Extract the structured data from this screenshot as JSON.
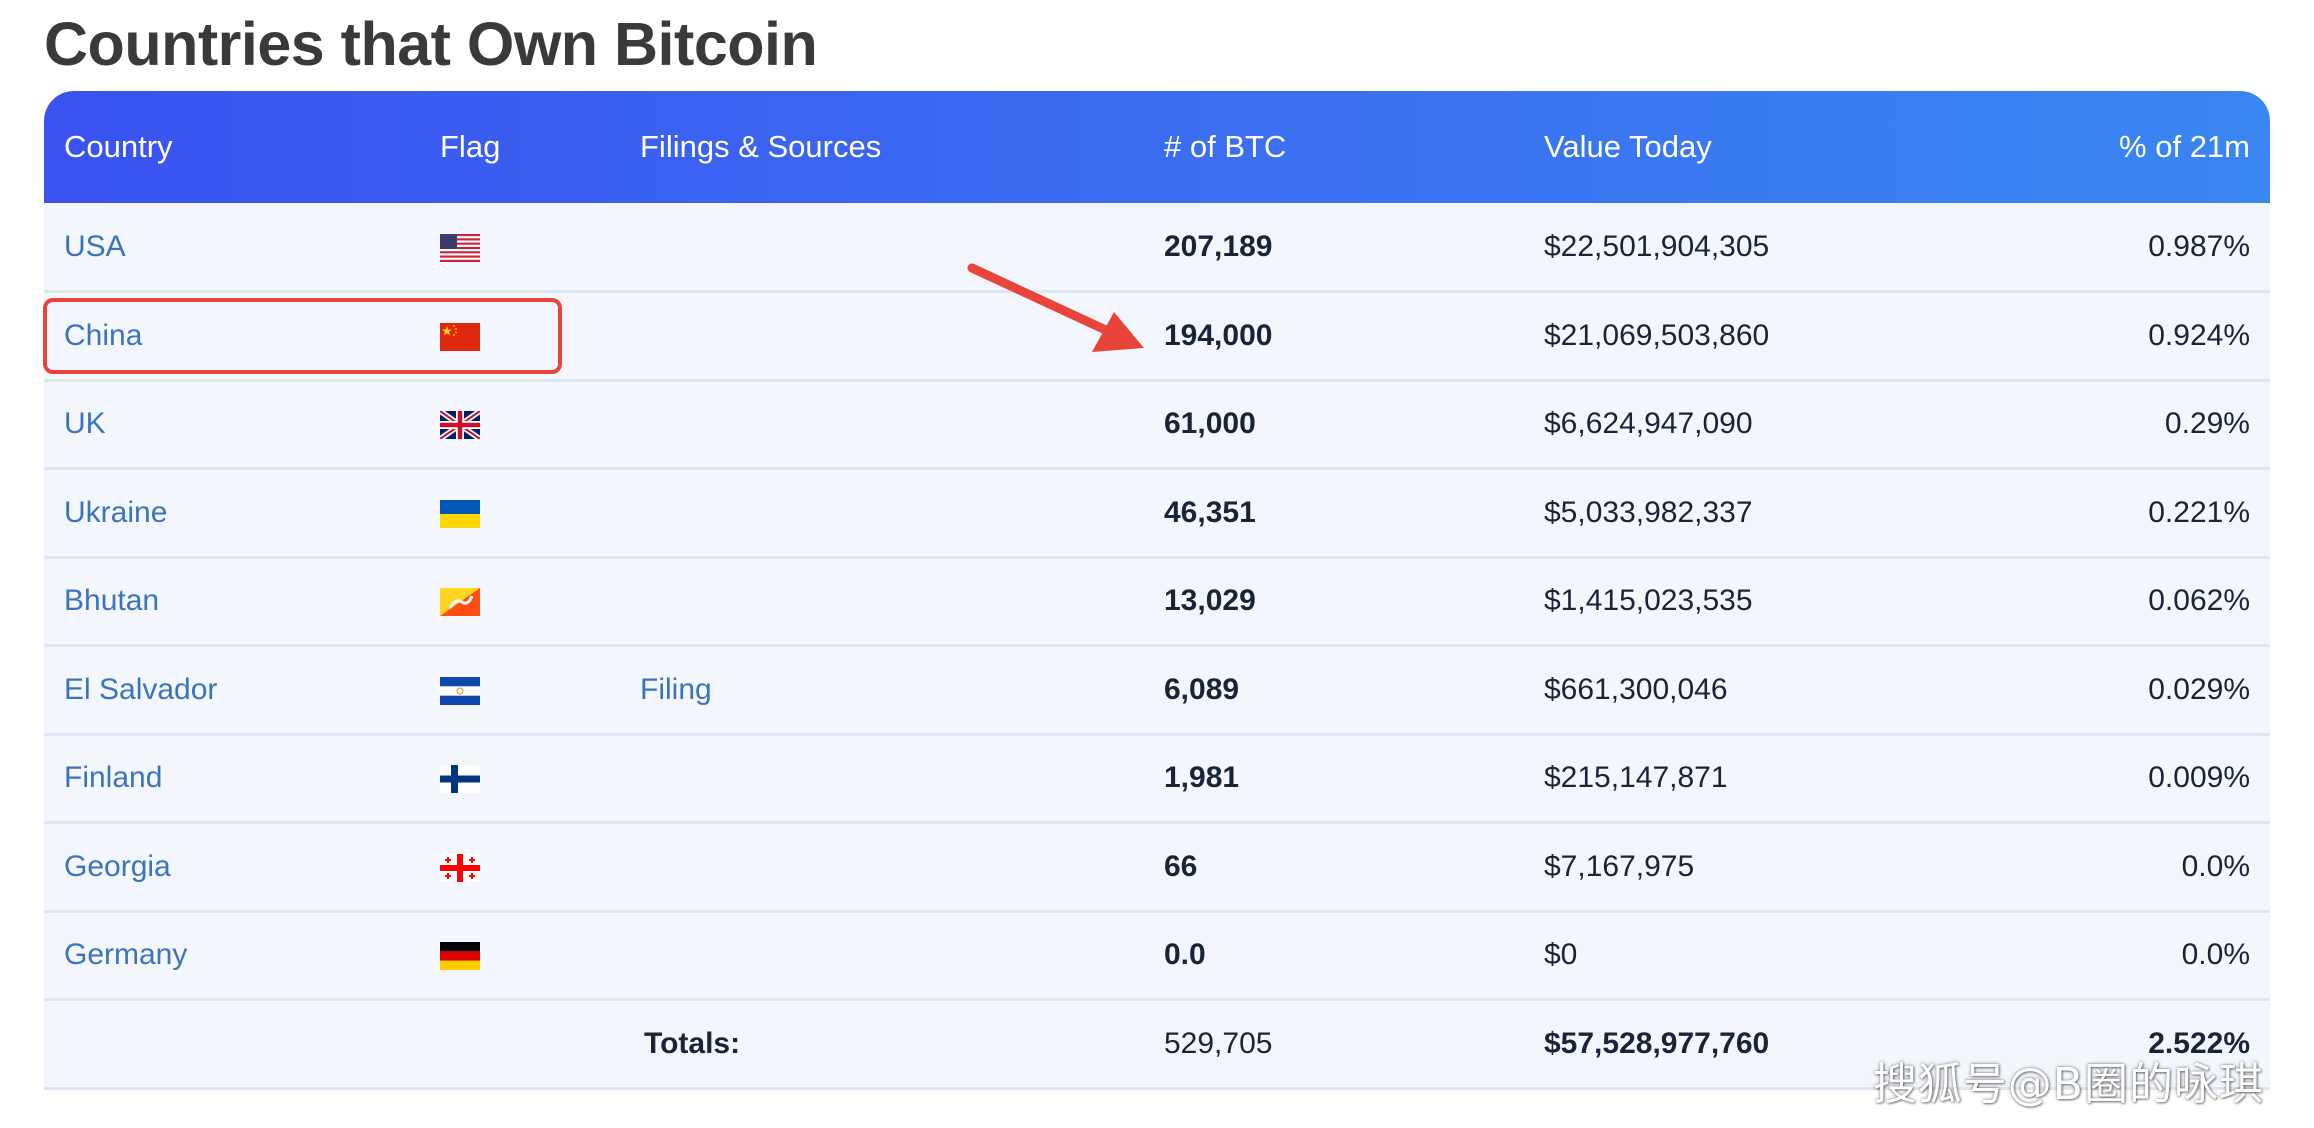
{
  "title": "Countries that Own Bitcoin",
  "columns": {
    "country": "Country",
    "flag": "Flag",
    "filings": "Filings & Sources",
    "btc": "# of BTC",
    "value": "Value Today",
    "pct": "% of 21m"
  },
  "rows": [
    {
      "country": "USA",
      "flag": "us-flag-icon",
      "filing": "",
      "btc": "207,189",
      "value": "$22,501,904,305",
      "pct": "0.987%"
    },
    {
      "country": "China",
      "flag": "cn-flag-icon",
      "filing": "",
      "btc": "194,000",
      "value": "$21,069,503,860",
      "pct": "0.924%"
    },
    {
      "country": "UK",
      "flag": "uk-flag-icon",
      "filing": "",
      "btc": "61,000",
      "value": "$6,624,947,090",
      "pct": "0.29%"
    },
    {
      "country": "Ukraine",
      "flag": "ua-flag-icon",
      "filing": "",
      "btc": "46,351",
      "value": "$5,033,982,337",
      "pct": "0.221%"
    },
    {
      "country": "Bhutan",
      "flag": "bt-flag-icon",
      "filing": "",
      "btc": "13,029",
      "value": "$1,415,023,535",
      "pct": "0.062%"
    },
    {
      "country": "El Salvador",
      "flag": "sv-flag-icon",
      "filing": "Filing",
      "btc": "6,089",
      "value": "$661,300,046",
      "pct": "0.029%"
    },
    {
      "country": "Finland",
      "flag": "fi-flag-icon",
      "filing": "",
      "btc": "1,981",
      "value": "$215,147,871",
      "pct": "0.009%"
    },
    {
      "country": "Georgia",
      "flag": "ge-flag-icon",
      "filing": "",
      "btc": "66",
      "value": "$7,167,975",
      "pct": "0.0%"
    },
    {
      "country": "Germany",
      "flag": "de-flag-icon",
      "filing": "",
      "btc": "0.0",
      "value": "$0",
      "pct": "0.0%"
    }
  ],
  "totals": {
    "label": "Totals:",
    "btc": "529,705",
    "value": "$57,528,977,760",
    "pct": "2.522%"
  },
  "watermark": "搜狐号@B圈的咏琪",
  "colors": {
    "header_start": "#3a52f0",
    "header_end": "#3a86f2",
    "row_bg": "#f3f6fc",
    "link": "#3b74bd",
    "highlight": "#e8443a"
  }
}
